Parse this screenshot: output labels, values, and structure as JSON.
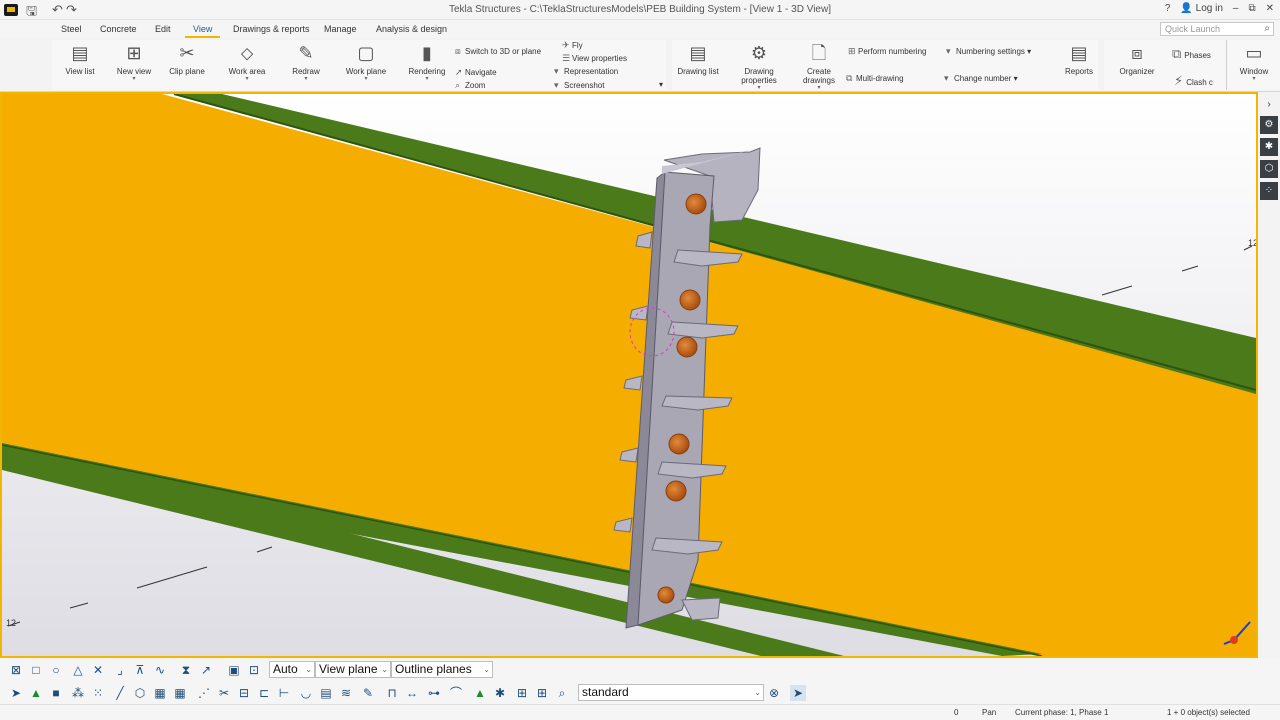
{
  "titlebar": {
    "title": "Tekla Structures - C:\\TeklaStructuresModels\\PEB Building System - [View 1 - 3D View]",
    "help": "?",
    "login": "Log in",
    "minimize": "–",
    "restore": "⧉",
    "close": "✕"
  },
  "tabs": [
    "Steel",
    "Concrete",
    "Edit",
    "View",
    "Drawings & reports",
    "Manage",
    "Analysis & design"
  ],
  "active_tab": "View",
  "quick_launch": {
    "placeholder": "Quick Launch"
  },
  "ribbon": {
    "view_list": "View list",
    "new_view": "New view",
    "clip_plane": "Clip plane",
    "work_area": "Work area",
    "redraw": "Redraw",
    "work_plane": "Work plane",
    "rendering": "Rendering",
    "switch_3d": "Switch to 3D or plane",
    "navigate": "Navigate",
    "zoom": "Zoom",
    "fly": "Fly",
    "view_properties": "View properties",
    "representation": "Representation",
    "screenshot": "Screenshot",
    "drawing_list": "Drawing list",
    "drawing_properties": "Drawing properties",
    "create_drawings": "Create drawings",
    "perform_numbering": "Perform numbering",
    "multi_drawing": "Multi-drawing",
    "numbering_settings": "Numbering settings",
    "change_number": "Change number",
    "reports": "Reports",
    "organizer": "Organizer",
    "phases": "Phases",
    "clash": "Clash c",
    "window": "Window"
  },
  "toolbar": {
    "auto_select": "Auto",
    "view_plane_select": "View plane",
    "outline_planes_select": "Outline planes",
    "filter_select": "standard"
  },
  "statusbar": {
    "zero": "0",
    "pan": "Pan",
    "current_phase": "Current phase: 1, Phase 1",
    "selection": "1 + 0 object(s) selected"
  },
  "viewport": {
    "grid_label_left": "12",
    "grid_label_right": "12"
  },
  "colors": {
    "accent": "#f2b600",
    "rafter_orange": "#f5ad00",
    "flange_green": "#4a7a1a",
    "steel_plate": "#a9a7b4",
    "bolt": "#c8641a"
  }
}
